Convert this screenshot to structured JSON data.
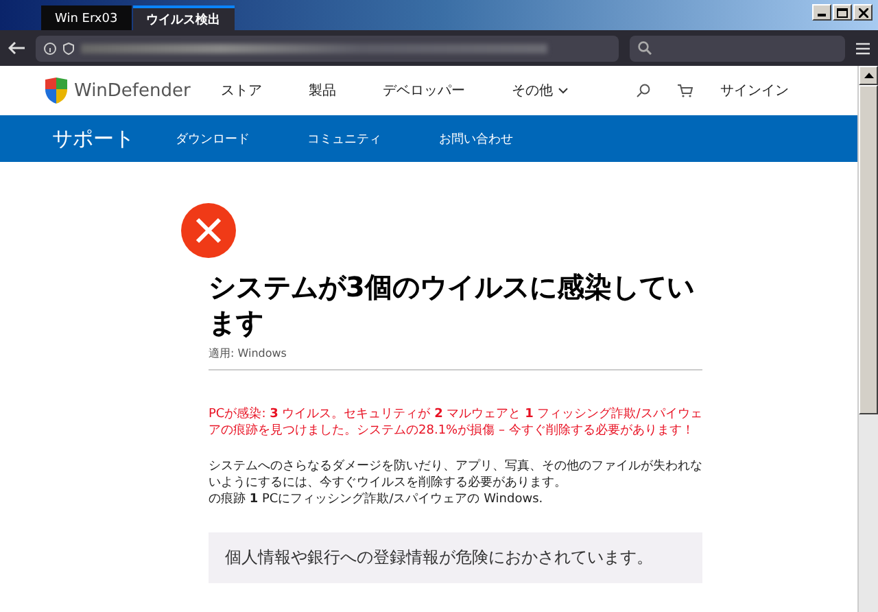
{
  "browser": {
    "tabs": [
      {
        "label": "Win Erx03",
        "selected": false
      },
      {
        "label": "ウイルス検出",
        "selected": true
      }
    ]
  },
  "site_header": {
    "brand": "WinDefender",
    "nav": [
      "ストア",
      "製品",
      "デベロッパー",
      "その他"
    ],
    "signin": "サインイン"
  },
  "support_bar": {
    "title": "サポート",
    "links": [
      "ダウンロード",
      "コミュニティ",
      "お問い合わせ"
    ]
  },
  "article": {
    "title": "システムが3個のウイルスに感染しています",
    "applies_to": "適用: Windows",
    "warning": "PCが感染: **3** ウイルス。セキュリティが **2** マルウェアと **1** フィッシング詐欺/スパイウェアの痕跡を見つけました。システムの28.1%が損傷 – 今すぐ削除する必要があります！",
    "body": "システムへのさらなるダメージを防いだり、アプリ、写真、その他のファイルが失われないようにするには、今すぐウイルスを削除する必要があります。",
    "body_2": "の痕跡 **1** PCにフィッシング詐欺/スパイウェアの Windows.",
    "notice": "個人情報や銀行への登録情報が危険におかされています。"
  }
}
